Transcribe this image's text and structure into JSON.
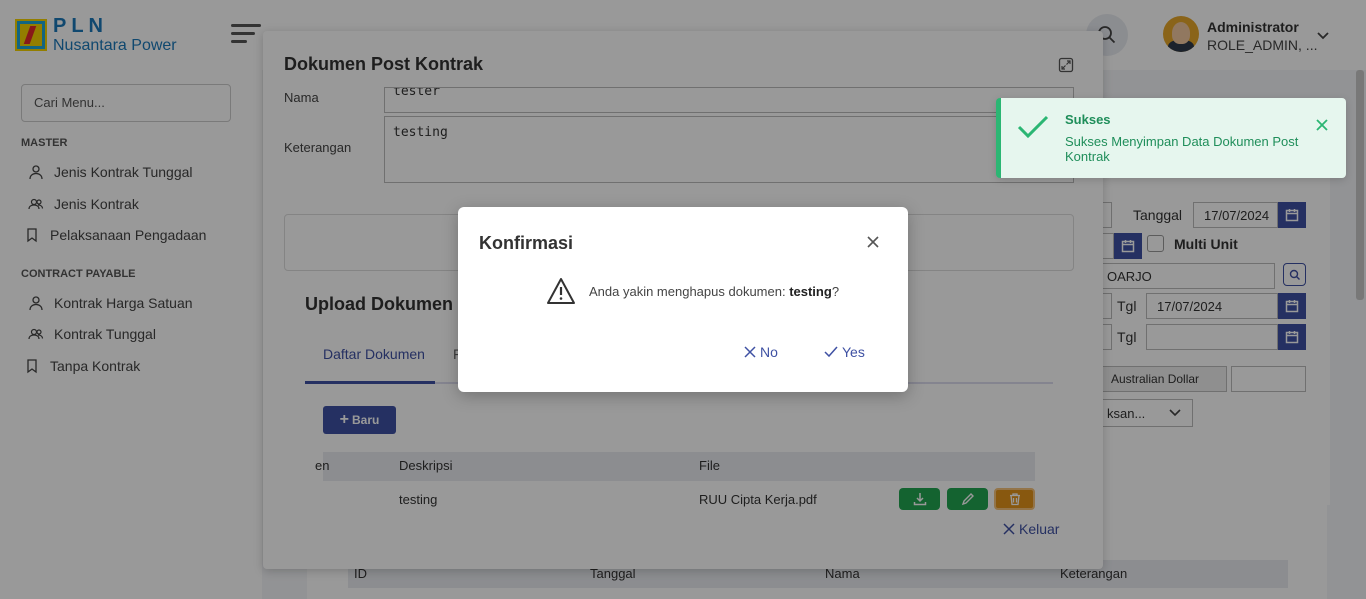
{
  "brand": {
    "line1": "PLN",
    "line2": "Nusantara Power"
  },
  "sidebar": {
    "search_placeholder": "Cari Menu...",
    "sections": [
      {
        "title": "MASTER",
        "items": [
          "Jenis Kontrak Tunggal",
          "Jenis Kontrak",
          "Pelaksanaan Pengadaan"
        ]
      },
      {
        "title": "CONTRACT PAYABLE",
        "items": [
          "Kontrak Harga Satuan",
          "Kontrak Tunggal",
          "Tanpa Kontrak"
        ]
      }
    ]
  },
  "header": {
    "user_name": "Administrator",
    "user_role": "ROLE_ADMIN, ..."
  },
  "background_form": {
    "tanggal_label": "Tanggal",
    "tanggal_value": "17/07/2024",
    "multi_unit_label": "Multi Unit",
    "location_value": "OARJO",
    "tgl_label_1": "Tgl",
    "tgl_value_1": "17/07/2024",
    "tgl_label_2": "Tgl",
    "currency_value": "Australian Dollar",
    "select_value": "ksan...",
    "table_headers": [
      "ID",
      "Tanggal",
      "Nama",
      "Keterangan"
    ]
  },
  "modal": {
    "title": "Dokumen Post Kontrak",
    "nama_label": "Nama",
    "nama_value": "tester",
    "keterangan_label": "Keterangan",
    "keterangan_value": "testing",
    "upload_title": "Upload Dokumen Pe",
    "tab_active": "Daftar Dokumen",
    "tab_other": "F",
    "new_button": "Baru",
    "table_headers": [
      "en",
      "Deskripsi",
      "File"
    ],
    "row": {
      "deskripsi": "testing",
      "file": "RUU Cipta Kerja.pdf"
    },
    "close_label": "Keluar"
  },
  "confirm": {
    "title": "Konfirmasi",
    "message_prefix": "Anda yakin menghapus dokumen: ",
    "message_item": "testing",
    "message_suffix": "?",
    "no_label": "No",
    "yes_label": "Yes"
  },
  "toast": {
    "title": "Sukses",
    "message": "Sukses Menyimpan Data Dokumen Post Kontrak"
  },
  "colors": {
    "primary": "#3f51a3",
    "success": "#2bb673",
    "download": "#22a551",
    "edit": "#22a551",
    "delete": "#e3931a"
  }
}
